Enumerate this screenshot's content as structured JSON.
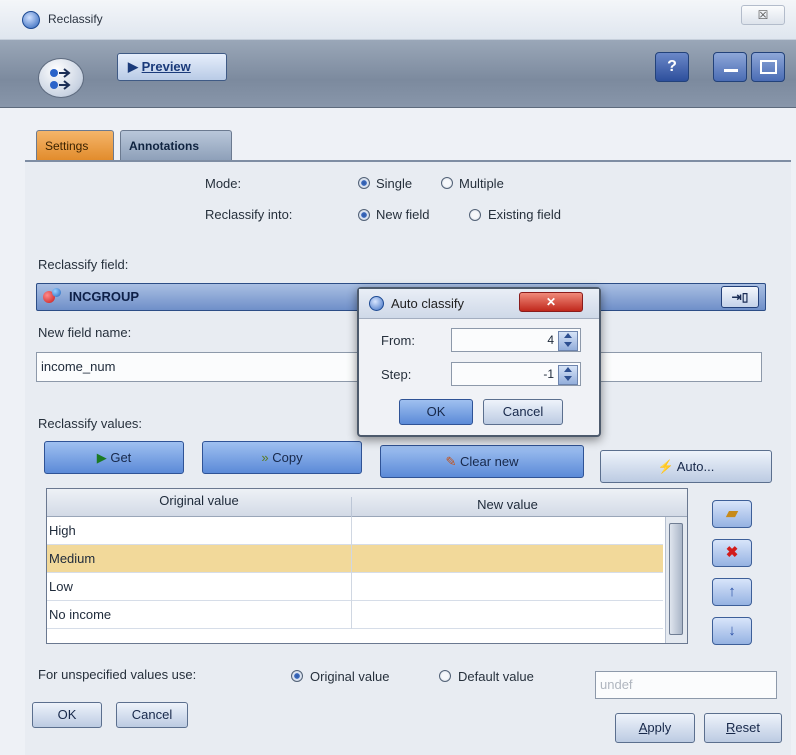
{
  "window": {
    "title": "Reclassify",
    "close": "☒"
  },
  "toolbar": {
    "preview_label": "Preview",
    "help": "?"
  },
  "tabs": [
    {
      "label": "Settings"
    },
    {
      "label": "Annotations"
    }
  ],
  "mode": {
    "label": "Mode:",
    "options": [
      "Single",
      "Multiple"
    ],
    "selected": "Single"
  },
  "reclassify_into": {
    "label": "Reclassify into:",
    "options": [
      "New field",
      "Existing field"
    ],
    "selected": "New field"
  },
  "reclassify_field": {
    "label": "Reclassify field:",
    "value": "INCGROUP"
  },
  "new_field": {
    "label": "New field name:",
    "value": "income_num"
  },
  "values_section": {
    "label": "Reclassify values:"
  },
  "buttons": {
    "get": "Get",
    "copy": "Copy",
    "clear_new": "Clear new",
    "auto": "Auto..."
  },
  "table": {
    "columns": [
      "Original value",
      "New value"
    ],
    "rows": [
      {
        "original": "High",
        "new": ""
      },
      {
        "original": "Medium",
        "new": ""
      },
      {
        "original": "Low",
        "new": ""
      },
      {
        "original": "No income",
        "new": ""
      }
    ],
    "selected_row": "Medium"
  },
  "unspecified": {
    "label": "For unspecified values use:",
    "options": [
      "Original value",
      "Default value"
    ],
    "selected": "Original value",
    "default_value": "undef"
  },
  "footer": {
    "ok": "OK",
    "cancel": "Cancel",
    "apply": "Apply",
    "reset": "Reset"
  },
  "dialog": {
    "title": "Auto classify",
    "from_label": "From:",
    "from_value": "4",
    "step_label": "Step:",
    "step_value": "-1",
    "ok": "OK",
    "cancel": "Cancel"
  },
  "colors": {
    "settings_tab": "#e28c2c",
    "field_bar": "#6f8fc9",
    "selected_row": "#f2d99a",
    "close_red": "#c0281c"
  }
}
